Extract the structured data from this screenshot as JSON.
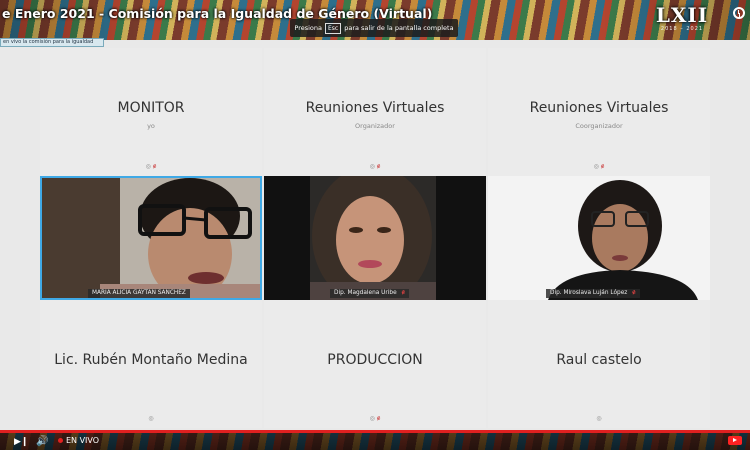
{
  "stream_title": "e Enero 2021 - Comisión para la Igualdad de Género (Virtual)",
  "esc_hint": {
    "before": "Presiona",
    "key": "Esc",
    "after": "para salir de la pantalla completa"
  },
  "logo": {
    "text": "LXII",
    "sub": "2018 – 2021"
  },
  "ticker_text": "en vivo la comisión para la igualdad",
  "participants": [
    {
      "name": "MONITOR",
      "role": "yo",
      "type": "placeholder"
    },
    {
      "name": "Reuniones Virtuales",
      "role": "Organizador",
      "type": "placeholder"
    },
    {
      "name": "Reuniones Virtuales",
      "role": "Coorganizador",
      "type": "placeholder"
    },
    {
      "name": "MARIA ALICIA GAYTAN SANCHEZ",
      "type": "video",
      "active": true
    },
    {
      "name": "Dip. Magdalena Uribe",
      "type": "video"
    },
    {
      "name": "Dip. Miroslava Luján López",
      "type": "video"
    },
    {
      "name": "Lic. Rubén Montaño Medina",
      "type": "placeholder"
    },
    {
      "name": "PRODUCCION",
      "type": "placeholder"
    },
    {
      "name": "Raul castelo",
      "type": "placeholder"
    }
  ],
  "tile_icons": {
    "pin": "◎",
    "mic_muted": "ɇ"
  },
  "player": {
    "live_label": "EN VIVO",
    "play_next": "▶❙",
    "volume": "🔊"
  },
  "colors": {
    "active_outline": "#3fa9e6",
    "live_red": "#e02020"
  }
}
